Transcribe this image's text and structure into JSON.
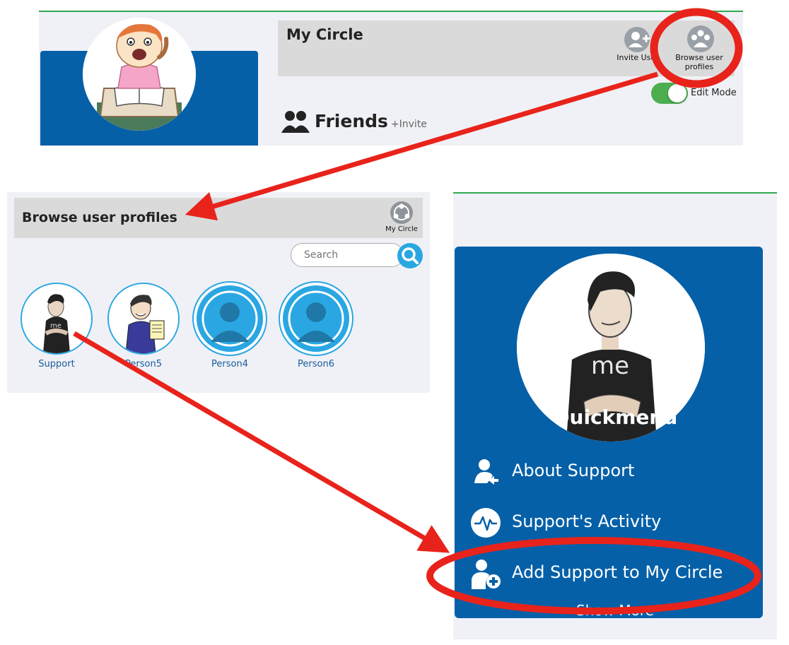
{
  "top_panel": {
    "header_title": "My Circle",
    "invite_user_label": "Invite User",
    "browse_profiles_label": "Browse user profiles",
    "edit_mode_label": "Edit Mode",
    "friends_title": "Friends",
    "friends_invite": "+Invite",
    "edit_mode_on": true
  },
  "browse_panel": {
    "title": "Browse user profiles",
    "my_circle_label": "My Circle",
    "search_placeholder": "Search",
    "profiles": [
      {
        "name": "Support"
      },
      {
        "name": "Person5"
      },
      {
        "name": "Person4"
      },
      {
        "name": "Person6"
      }
    ]
  },
  "quickmenu": {
    "title": "Quickmenu",
    "items": [
      {
        "label": "About Support",
        "icon": "user-info-icon"
      },
      {
        "label": "Support's Activity",
        "icon": "activity-pulse-icon"
      },
      {
        "label": "Add Support to My Circle",
        "icon": "add-user-icon"
      }
    ],
    "show_more": "Show More"
  },
  "colors": {
    "brand_blue": "#0560a8",
    "accent_cyan": "#2aa7e2",
    "toggle_green": "#4cae4f",
    "annotation_red": "#e8231b",
    "header_gray": "#dadada",
    "panel_bg": "#f0f1f6"
  }
}
